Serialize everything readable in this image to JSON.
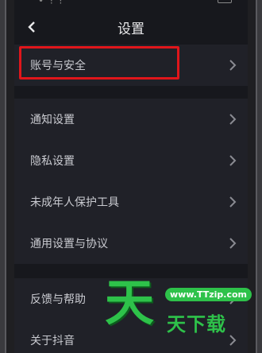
{
  "status": {
    "dots": "• ⁝ ⁝"
  },
  "header": {
    "title": "设置"
  },
  "groups": [
    {
      "items": [
        {
          "label": "账号与安全"
        }
      ]
    },
    {
      "items": [
        {
          "label": "通知设置"
        },
        {
          "label": "隐私设置"
        },
        {
          "label": "未成年人保护工具"
        },
        {
          "label": "通用设置与协议"
        }
      ]
    },
    {
      "items": [
        {
          "label": "反馈与帮助"
        },
        {
          "label": "关于抖音"
        }
      ]
    }
  ],
  "watermark": {
    "big": "天",
    "url": "www.TTzip.com",
    "sub": "天下载"
  },
  "colors": {
    "highlight": "#e0161b",
    "watermark": "#2ec24a"
  }
}
